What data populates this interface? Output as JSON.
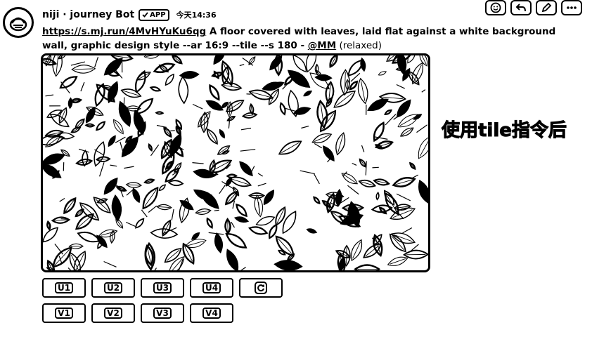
{
  "message": {
    "username": "niji · journey Bot",
    "badge": "APP",
    "timestamp": "今天14:36",
    "prompt_link": "https://s.mj.run/4MvHYuKu6qg",
    "prompt_text": " A floor covered with leaves, laid flat against a white background wall, graphic design style --ar 16:9 --tile --s 180 - ",
    "mention": "@MM",
    "mode": " (relaxed)"
  },
  "annotation": "使用tile指令后",
  "buttons": {
    "upscale": [
      "U1",
      "U2",
      "U3",
      "U4"
    ],
    "variation": [
      "V1",
      "V2",
      "V3",
      "V4"
    ],
    "reroll_icon": "refresh-icon"
  },
  "icons": {
    "avatar": "niji-bot-avatar",
    "actions": [
      "emoji-icon",
      "reply-icon",
      "edit-icon",
      "more-icon"
    ]
  }
}
